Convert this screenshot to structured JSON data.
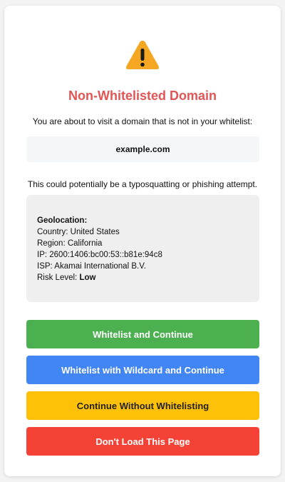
{
  "dialog": {
    "title": "Non-Whitelisted Domain",
    "intro": "You are about to visit a domain that is not in your whitelist:",
    "domain": "example.com",
    "warning": "This could potentially be a typosquatting or phishing attempt."
  },
  "geolocation": {
    "heading": "Geolocation:",
    "country_label": "Country:",
    "country": "United States",
    "region_label": "Region:",
    "region": "California",
    "ip_label": "IP:",
    "ip": "2600:1406:bc00:53::b81e:94c8",
    "isp_label": "ISP:",
    "isp": "Akamai International B.V.",
    "risk_label": "Risk Level:",
    "risk_level": "Low"
  },
  "buttons": {
    "whitelist": "Whitelist and Continue",
    "wildcard": "Whitelist with Wildcard and Continue",
    "continue": "Continue Without Whitelisting",
    "block": "Don't Load This Page"
  },
  "colors": {
    "title": "#e25555",
    "warning_icon": "#f5a623",
    "whitelist_button": "#4caf50",
    "wildcard_button": "#4285f4",
    "continue_button": "#ffc107",
    "block_button": "#f44336"
  },
  "icons": {
    "warning": "warning-triangle-icon"
  }
}
